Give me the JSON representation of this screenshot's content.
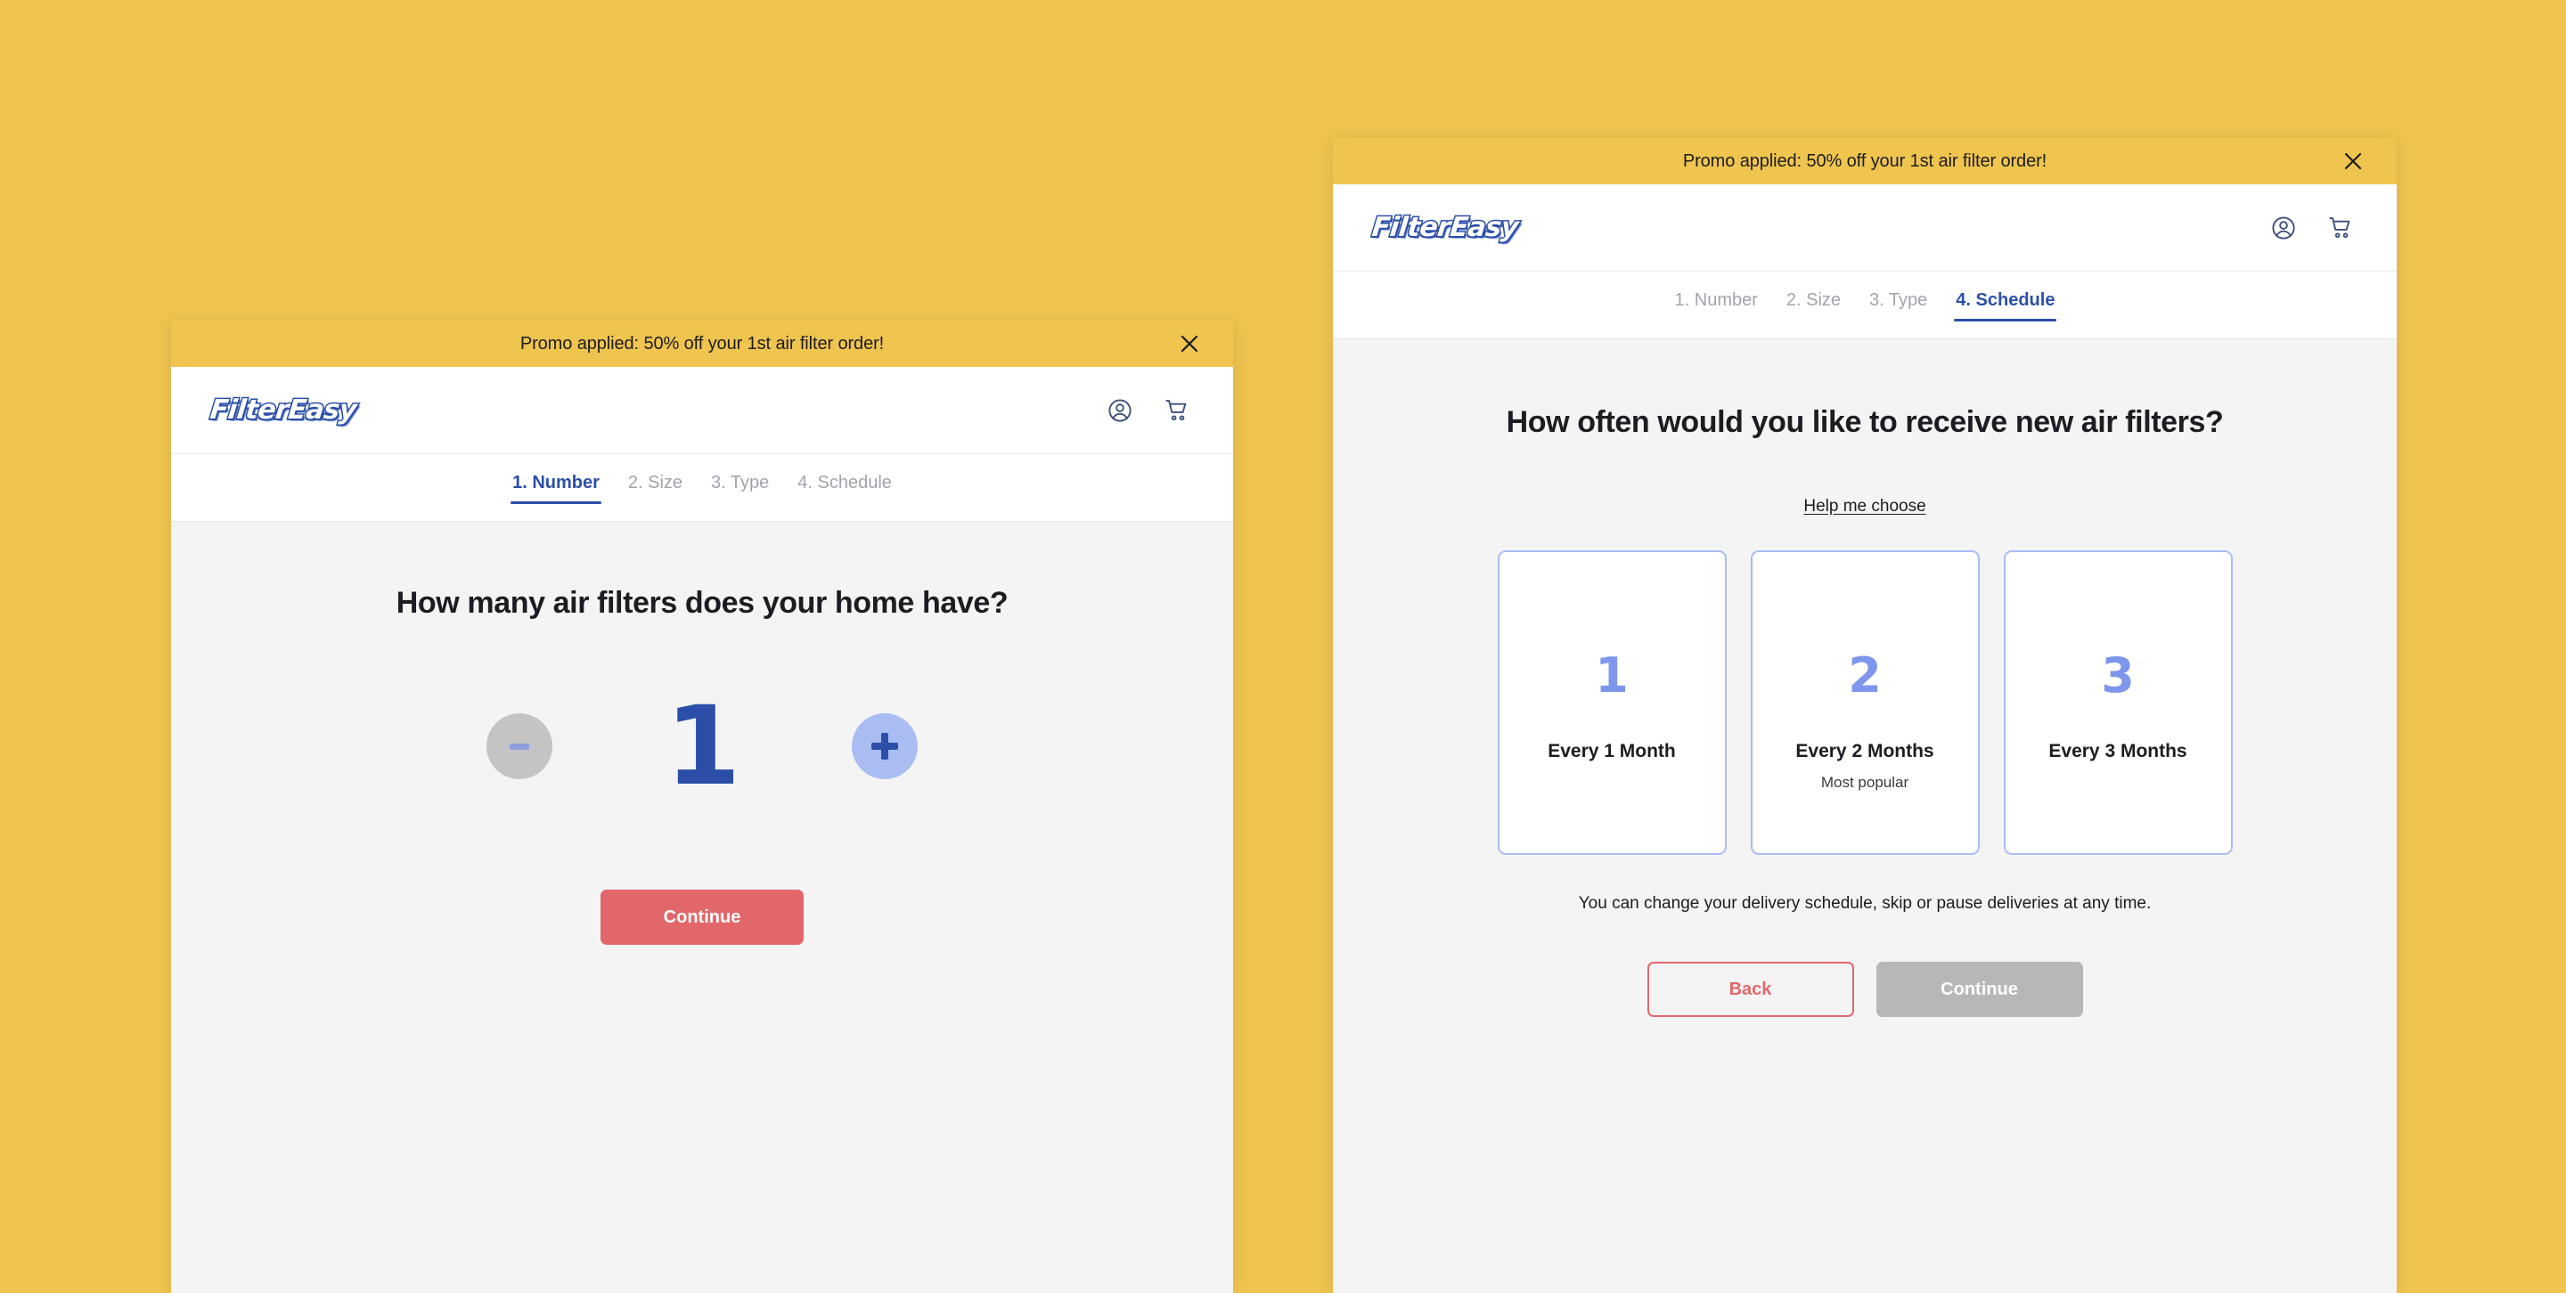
{
  "theme": {
    "page_background": "#EFC44F",
    "promo_background": "#EFC44F",
    "brand_blue": "#2B4FA8",
    "accent_periwinkle": "#A9BDF3",
    "coral": "#E2676B",
    "disabled_gray": "#B7B7B7",
    "body_background": "#F4F4F4"
  },
  "promo": {
    "text": "Promo applied: 50% off your 1st air filter order!",
    "close_icon": "close-icon"
  },
  "header": {
    "logo_text": "FilterEasy",
    "account_icon": "account-circle-icon",
    "cart_icon": "shopping-cart-icon"
  },
  "steps": [
    {
      "label": "1. Number"
    },
    {
      "label": "2. Size"
    },
    {
      "label": "3. Type"
    },
    {
      "label": "4. Schedule"
    }
  ],
  "left_panel": {
    "active_step_index": 0,
    "question": "How many air filters does your home have?",
    "counter": {
      "value": "1",
      "decrement_icon": "minus-icon",
      "decrement_label": "-",
      "increment_icon": "plus-icon",
      "increment_label": "+",
      "decrement_disabled": true
    },
    "continue_label": "Continue"
  },
  "right_panel": {
    "active_step_index": 3,
    "question": "How often would you like to receive new air filters?",
    "help_link_label": "Help me choose",
    "options": [
      {
        "number": "1",
        "label": "Every 1 Month",
        "sub": ""
      },
      {
        "number": "2",
        "label": "Every 2 Months",
        "sub": "Most popular"
      },
      {
        "number": "3",
        "label": "Every 3 Months",
        "sub": ""
      }
    ],
    "note": "You can change your delivery schedule, skip or pause deliveries at any time.",
    "back_label": "Back",
    "continue_label": "Continue",
    "continue_disabled": true
  }
}
